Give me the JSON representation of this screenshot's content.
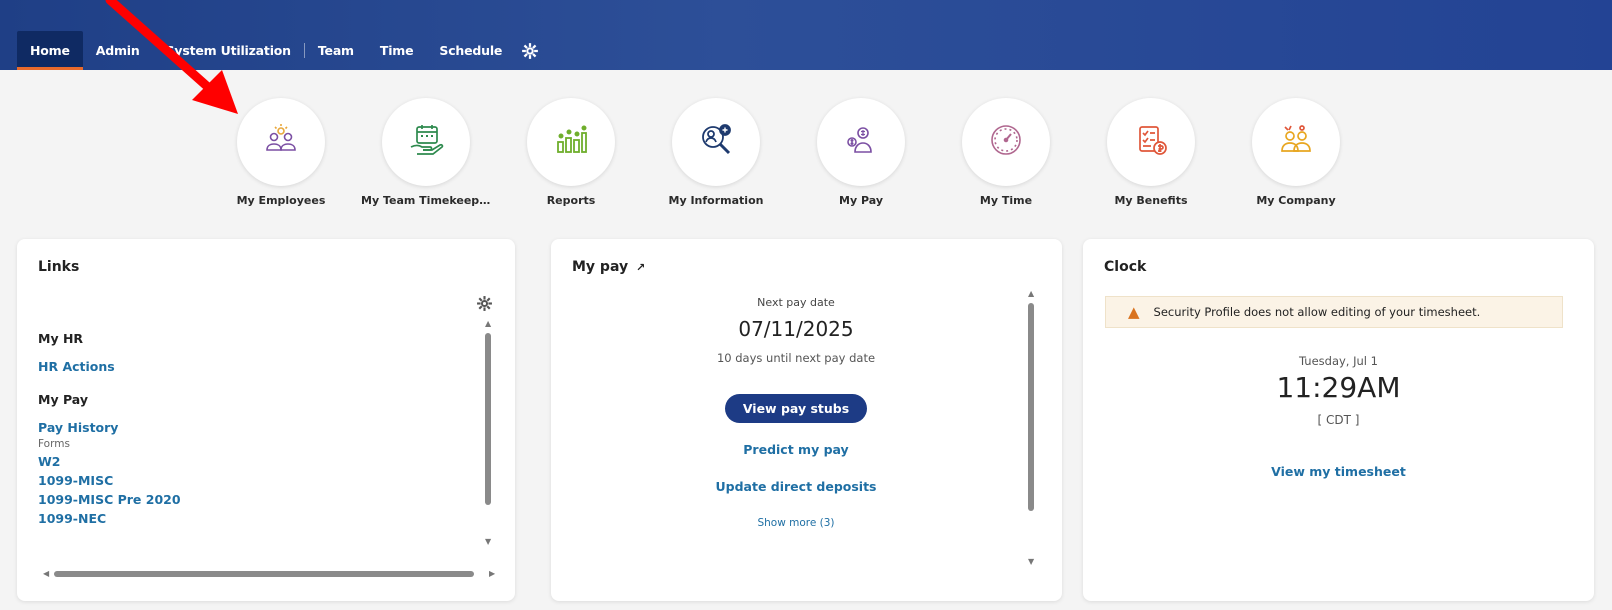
{
  "nav": {
    "items": [
      {
        "label": "Home",
        "active": true
      },
      {
        "label": "Admin"
      },
      {
        "label": "System Utilization"
      },
      {
        "label": "Team"
      },
      {
        "label": "Time"
      },
      {
        "label": "Schedule"
      }
    ],
    "settings_icon": "gear-icon"
  },
  "tiles": [
    {
      "label": "My Employees",
      "icon": "employees-icon"
    },
    {
      "label": "My Team Timekeepi...",
      "icon": "team-timekeeping-icon"
    },
    {
      "label": "Reports",
      "icon": "reports-icon"
    },
    {
      "label": "My Information",
      "icon": "my-information-icon"
    },
    {
      "label": "My Pay",
      "icon": "my-pay-icon"
    },
    {
      "label": "My Time",
      "icon": "my-time-icon"
    },
    {
      "label": "My Benefits",
      "icon": "my-benefits-icon"
    },
    {
      "label": "My Company",
      "icon": "my-company-icon"
    }
  ],
  "links_card": {
    "title": "Links",
    "sections": [
      {
        "heading": "My HR",
        "links": [
          "HR Actions"
        ]
      },
      {
        "heading": "My Pay",
        "links": [
          "Pay History"
        ],
        "sub": "Forms",
        "forms": [
          "W2",
          "1099-MISC",
          "1099-MISC Pre 2020",
          "1099-NEC"
        ]
      }
    ]
  },
  "pay_card": {
    "title": "My pay",
    "title_icon": "external-link-icon",
    "next_pay_label": "Next pay date",
    "next_pay_date": "07/11/2025",
    "days_until": "10 days until next pay date",
    "view_stubs": "View pay stubs",
    "predict": "Predict my pay",
    "update_deposits": "Update direct deposits",
    "show_more": "Show more (3)"
  },
  "clock_card": {
    "title": "Clock",
    "alert": "Security Profile does not allow editing of your timesheet.",
    "date": "Tuesday, Jul 1",
    "time": "11:29AM",
    "tz": "[ CDT ]",
    "view_timesheet": "View my timesheet"
  },
  "colors": {
    "nav_bg": "#23448f",
    "active_underline": "#e86a2b",
    "link": "#1f6fa4",
    "primary_button": "#1d3b85",
    "annotation_arrow": "#ff0000"
  }
}
